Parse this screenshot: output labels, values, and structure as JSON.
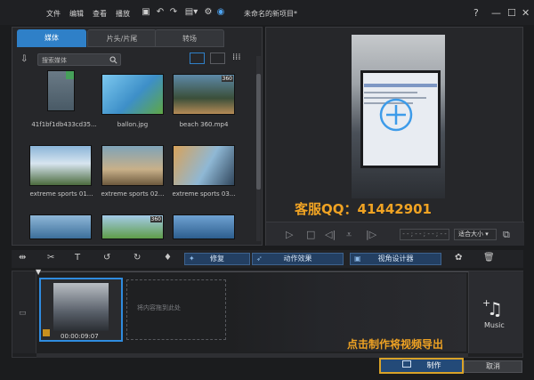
{
  "menu": [
    "文件",
    "编辑",
    "查看",
    "播放"
  ],
  "window_title": "未命名的新项目*",
  "window_controls": [
    "?",
    "—",
    "☐",
    "✕"
  ],
  "tabs": [
    "媒体",
    "片头/片尾",
    "转场"
  ],
  "search": {
    "placeholder": "搜索媒体"
  },
  "media": [
    {
      "label": "41f1bf1db433cd35..."
    },
    {
      "label": "ballon.jpg"
    },
    {
      "label": "beach 360.mp4",
      "badge": "360"
    },
    {
      "label": "extreme sports 01..."
    },
    {
      "label": "extreme sports 02..."
    },
    {
      "label": "extreme sports 03..."
    },
    {
      "label": ""
    },
    {
      "label": "",
      "badge": "360"
    },
    {
      "label": ""
    }
  ],
  "preview": {
    "timecode": "- - ; - - ; - - ; - -",
    "fit": "适合大小"
  },
  "watermark": {
    "qq": "客服QQ：41442901",
    "export_note": "点击制作将视频导出"
  },
  "toolbar": {
    "repair": "修复",
    "motion": "动作效果",
    "view_designer": "视角设计器"
  },
  "timeline": {
    "clip_time": "00:00:09:07",
    "drop_hint": "将内容拖到此处",
    "music": "Music"
  },
  "buttons": {
    "make": "制作",
    "cancel": "取消"
  },
  "colors": {
    "accent": "#2f80c8",
    "highlight": "#f0a323"
  }
}
